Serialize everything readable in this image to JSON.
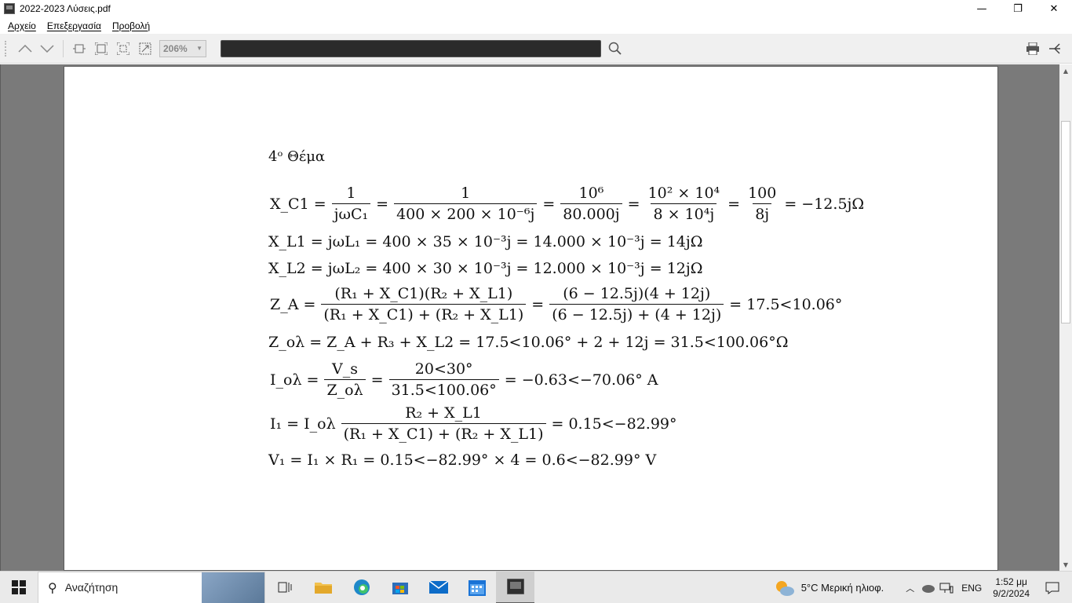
{
  "window": {
    "title": "2022-2023 Λύσεις.pdf",
    "minimize": "—",
    "maximize": "❐",
    "close": "✕"
  },
  "menu": [
    "Αρχείο",
    "Επεξεργασία",
    "Προβολή"
  ],
  "toolbar": {
    "zoom_value": "206%",
    "search_value": ""
  },
  "document": {
    "heading": "4ᵒ  Θέμα",
    "eq1": {
      "lhs": "X_C1 =",
      "f1_num": "1",
      "f1_den": "jωC₁",
      "eq": "=",
      "f2_num": "1",
      "f2_den": "400 × 200 × 10⁻⁶j",
      "f3_num": "10⁶",
      "f3_den": "80.000j",
      "f4_num": "10² × 10⁴",
      "f4_den": "8 × 10⁴j",
      "f5_num": "100",
      "f5_den": "8j",
      "rhs": "= −12.5jΩ"
    },
    "eq2": "X_L1 = jωL₁ = 400 × 35 × 10⁻³j = 14.000 × 10⁻³j = 14jΩ",
    "eq3": "X_L2 = jωL₂ = 400 × 30 × 10⁻³j = 12.000 × 10⁻³j = 12jΩ",
    "eq4": {
      "lhs": "Z_A =",
      "f1_num": "(R₁ + X_C1)(R₂ + X_L1)",
      "f1_den": "(R₁ + X_C1) + (R₂ + X_L1)",
      "f2_num": "(6 − 12.5j)(4 + 12j)",
      "f2_den": "(6 − 12.5j) + (4 + 12j)",
      "rhs": "= 17.5<10.06°"
    },
    "eq5": "Z_ολ = Z_A + R₃ + X_L2 = 17.5<10.06° + 2 + 12j = 31.5<100.06°Ω",
    "eq6": {
      "lhs": "I_ολ =",
      "f1_num": "V_s",
      "f1_den": "Z_ολ",
      "f2_num": "20<30°",
      "f2_den": "31.5<100.06°",
      "rhs": "= −0.63<−70.06° A"
    },
    "eq7": {
      "lhs": "I₁ = I_ολ",
      "f1_num": "R₂ + X_L1",
      "f1_den": "(R₁ + X_C1) + (R₂ + X_L1)",
      "rhs": "= 0.15<−82.99°"
    },
    "eq8": "V₁ = I₁ × R₁ = 0.15<−82.99° × 4 = 0.6<−82.99° V"
  },
  "taskbar": {
    "search_placeholder": "Αναζήτηση",
    "weather": "5°C  Μερική ηλιοφ.",
    "language": "ENG",
    "time": "1:52 μμ",
    "date": "9/2/2024"
  }
}
